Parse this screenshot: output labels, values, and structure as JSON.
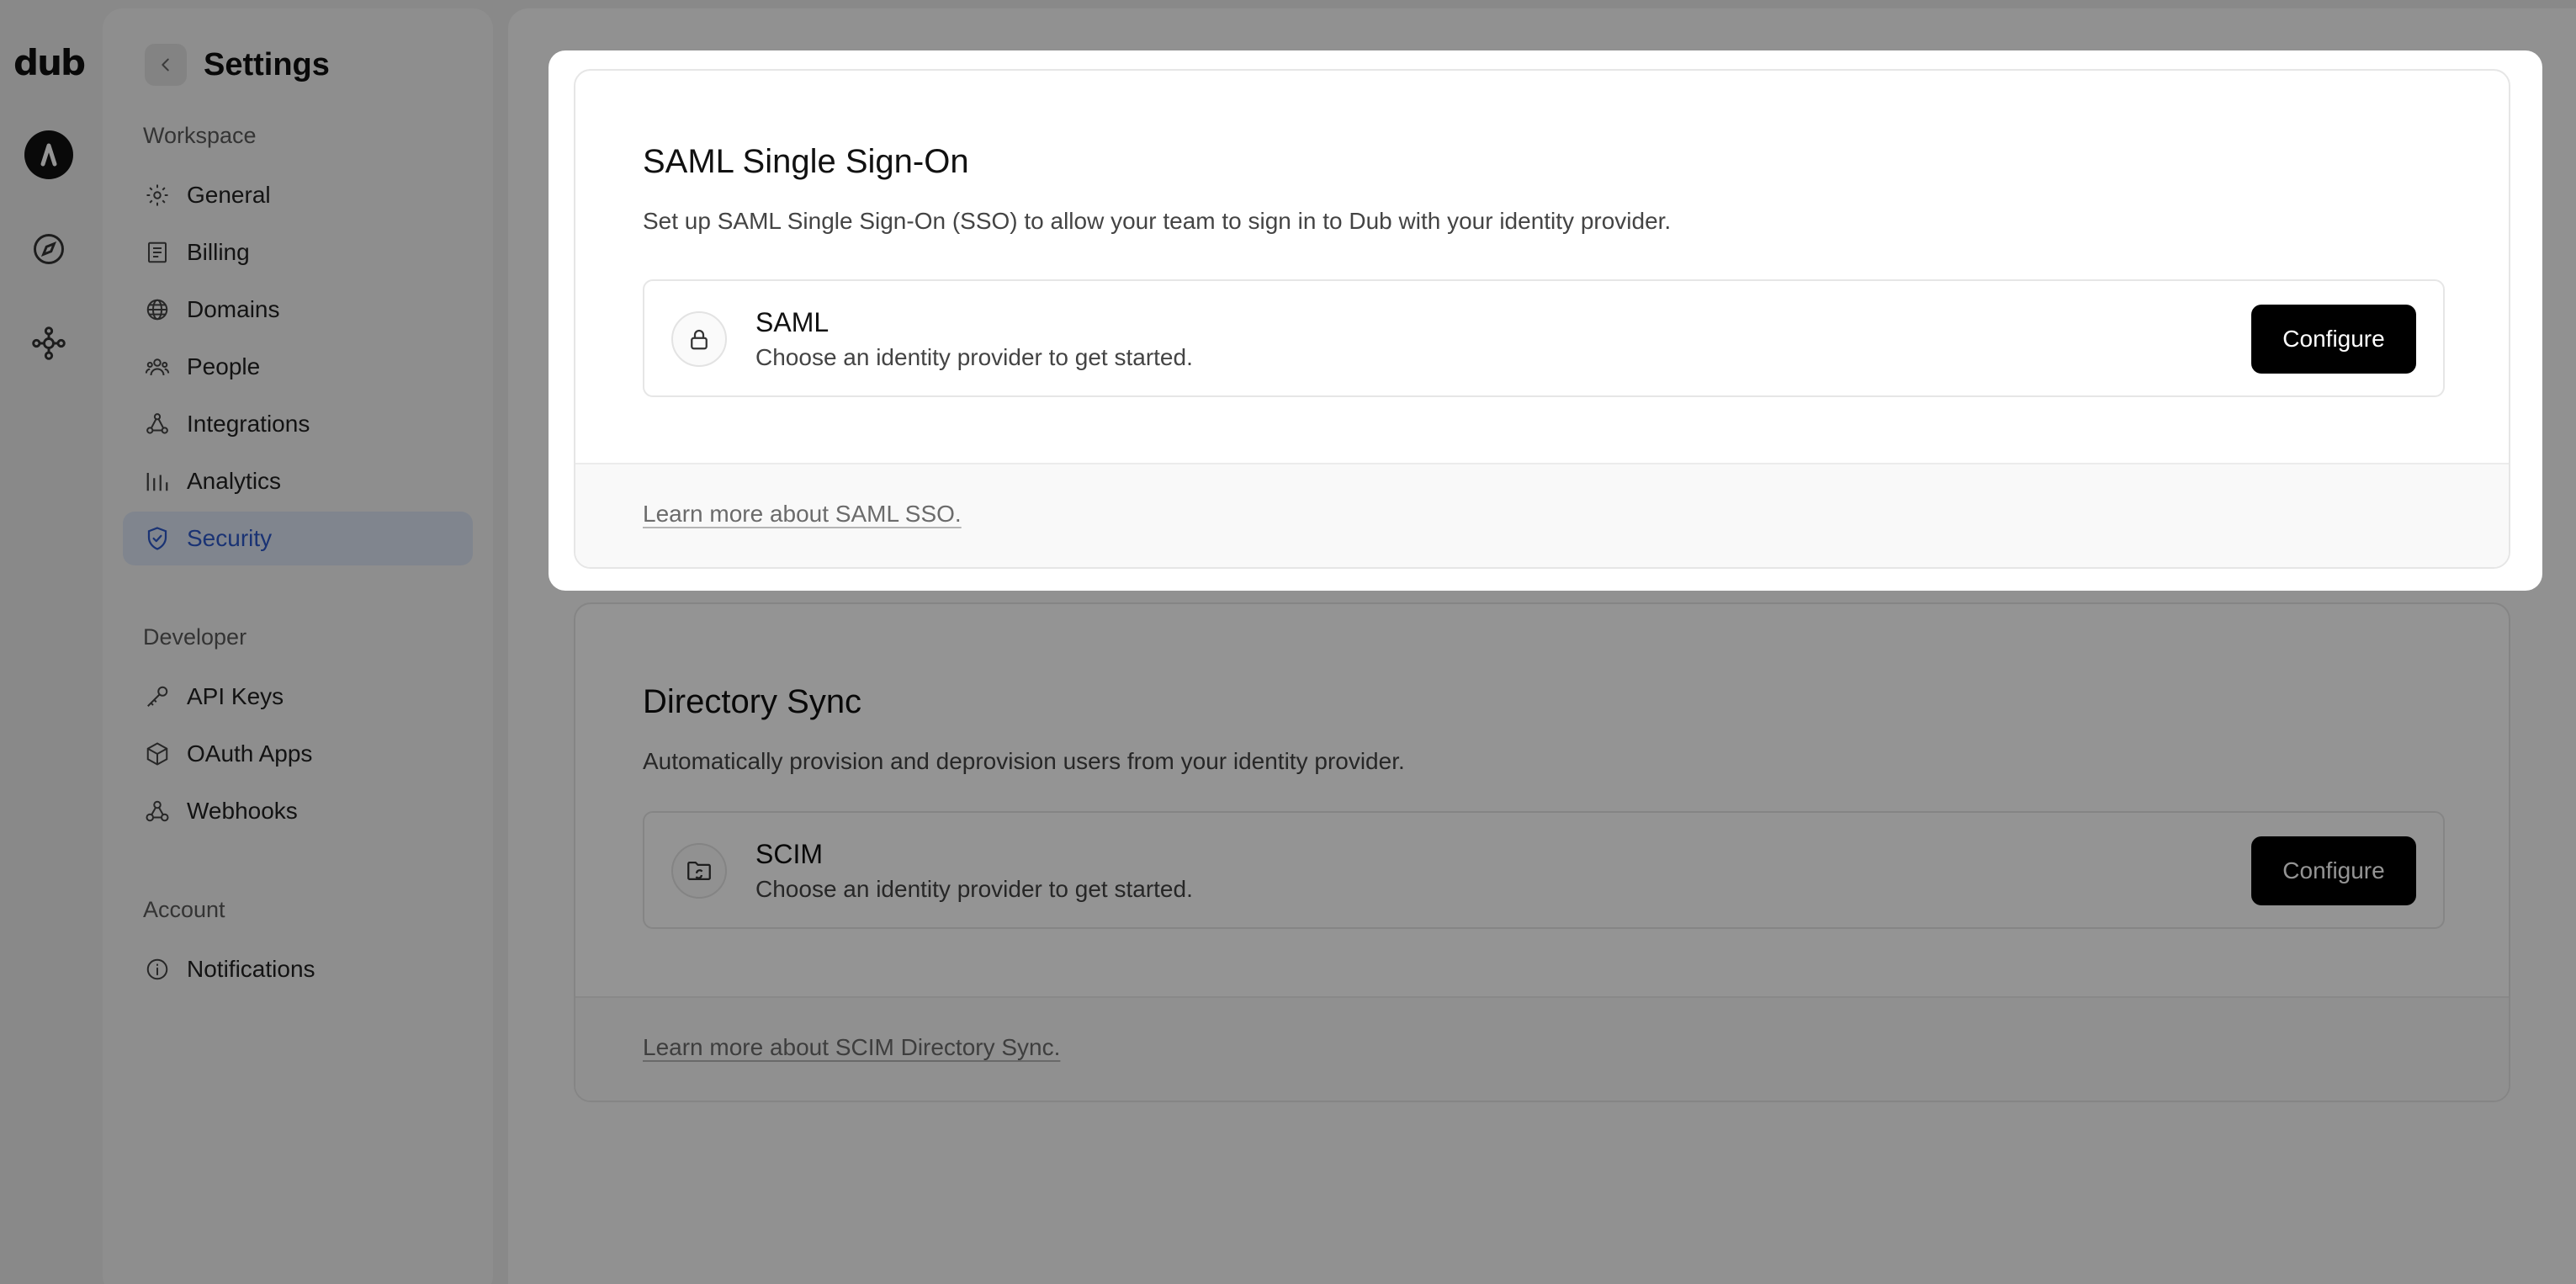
{
  "rail": {
    "logo": "dub",
    "icons": [
      "avatar",
      "compass-icon",
      "integrations-icon"
    ]
  },
  "sidebar": {
    "title": "Settings",
    "sections": [
      {
        "label": "Workspace",
        "items": [
          {
            "label": "General",
            "icon": "gear-icon"
          },
          {
            "label": "Billing",
            "icon": "receipt-icon"
          },
          {
            "label": "Domains",
            "icon": "globe-icon"
          },
          {
            "label": "People",
            "icon": "users-icon"
          },
          {
            "label": "Integrations",
            "icon": "integrations-icon"
          },
          {
            "label": "Analytics",
            "icon": "bar-chart-icon"
          },
          {
            "label": "Security",
            "icon": "shield-check-icon",
            "active": true
          }
        ]
      },
      {
        "label": "Developer",
        "items": [
          {
            "label": "API Keys",
            "icon": "key-icon"
          },
          {
            "label": "OAuth Apps",
            "icon": "box-icon"
          },
          {
            "label": "Webhooks",
            "icon": "webhook-icon"
          }
        ]
      },
      {
        "label": "Account",
        "items": [
          {
            "label": "Notifications",
            "icon": "info-icon"
          }
        ]
      }
    ]
  },
  "saml": {
    "title": "SAML Single Sign-On",
    "description": "Set up SAML Single Sign-On (SSO) to allow your team to sign in to Dub with your identity provider.",
    "provider": {
      "name": "SAML",
      "subtitle": "Choose an identity provider to get started.",
      "icon": "lock-icon",
      "button": "Configure"
    },
    "footer_link": "Learn more about SAML SSO."
  },
  "directory_sync": {
    "title": "Directory Sync",
    "description": "Automatically provision and deprovision users from your identity provider.",
    "provider": {
      "name": "SCIM",
      "subtitle": "Choose an identity provider to get started.",
      "icon": "folder-sync-icon",
      "button": "Configure"
    },
    "footer_link": "Learn more about SCIM Directory Sync."
  },
  "colors": {
    "active_nav_bg": "#dde5f4",
    "active_nav_text": "#2e59c8",
    "button_bg": "#000000",
    "overlay": "rgba(0,0,0,0.42)"
  }
}
